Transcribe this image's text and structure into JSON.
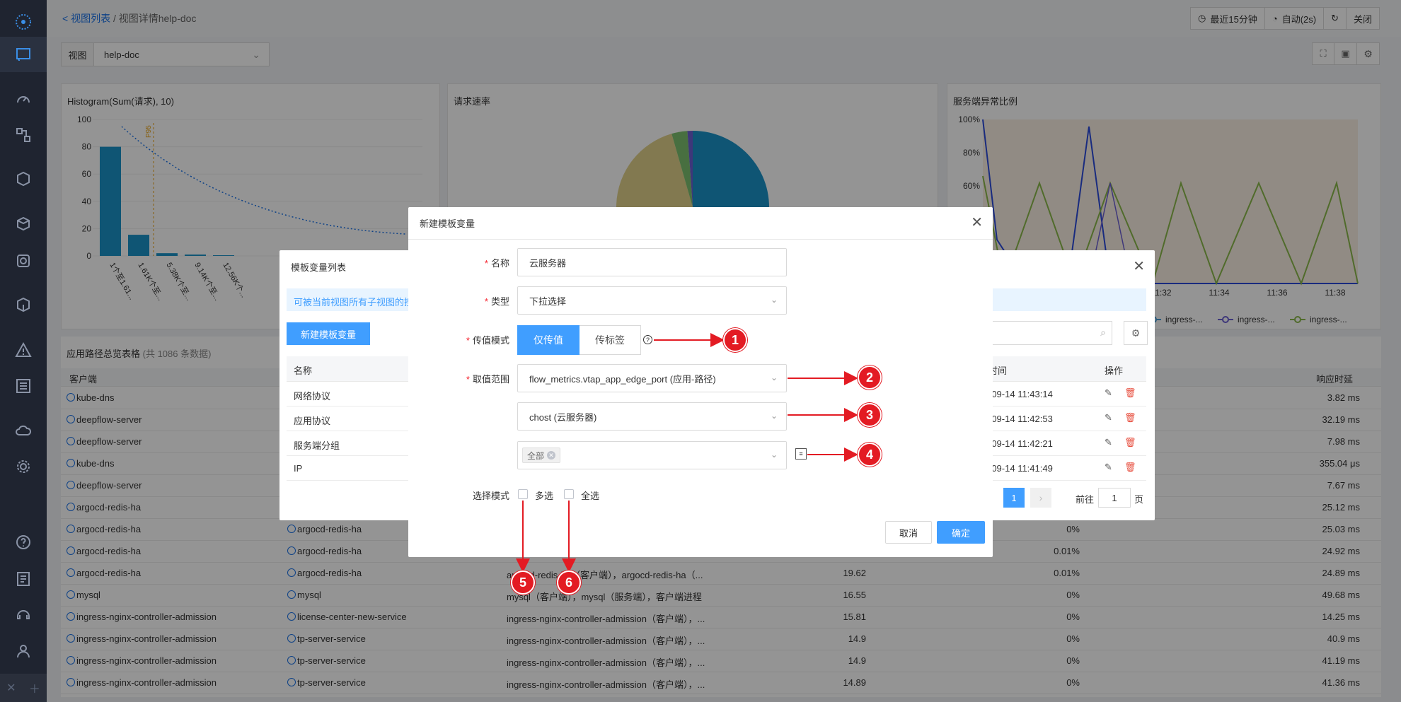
{
  "breadcrumb": {
    "back_link": "视图列表",
    "separator": "/",
    "current": "视图详情help-doc"
  },
  "topbar": {
    "time_range": "最近15分钟",
    "refresh": "自动(2s)",
    "close": "关闭"
  },
  "view_selector": {
    "label": "视图",
    "value": "help-doc"
  },
  "panels": {
    "histogram": {
      "title": "Histogram(Sum(请求), 10)",
      "y_ticks": [
        "100",
        "80",
        "60",
        "40",
        "20",
        "0"
      ],
      "x_labels": [
        "1个至1.61...",
        "1.61K个至...",
        "5.38K个至...",
        "9.14K个至...",
        "12.56K个..."
      ],
      "p95_label": "P95"
    },
    "rate": {
      "title": "请求速率"
    },
    "error_ratio": {
      "title": "服务端异常比例",
      "y_ticks": [
        "100%",
        "80%",
        "60%"
      ],
      "x_ticks": [
        "11:32",
        "11:34",
        "11:36",
        "11:38"
      ],
      "legend": [
        "ingress-...",
        "ingress-...",
        "ingress-..."
      ]
    }
  },
  "chart_data": [
    {
      "type": "bar",
      "title": "Histogram(Sum(请求), 10)",
      "categories": [
        "1个至1.61...",
        "1.61K个至...",
        "5.38K个至...",
        "9.14K个至...",
        "12.56K个..."
      ],
      "values": [
        80,
        15.5,
        2,
        1,
        0.5
      ],
      "ylim": [
        0,
        100
      ]
    },
    {
      "type": "pie",
      "title": "请求速率",
      "values": [
        50,
        36,
        3,
        1
      ]
    }
  ],
  "table": {
    "title": "应用路径总览表格",
    "count": "(共 1086 条数据)",
    "headers": {
      "client": "客户端",
      "latency": "响应时延"
    },
    "rows": [
      {
        "client": "kube-dns",
        "server": "",
        "path": "",
        "rate": "",
        "err": "",
        "latency": "3.82 ms"
      },
      {
        "client": "deepflow-server",
        "server": "",
        "path": "",
        "rate": "",
        "err": "",
        "latency": "32.19 ms"
      },
      {
        "client": "deepflow-server",
        "server": "",
        "path": "",
        "rate": "",
        "err": "",
        "latency": "7.98 ms"
      },
      {
        "client": "kube-dns",
        "server": "",
        "path": "",
        "rate": "",
        "err": "",
        "latency": "355.04 μs"
      },
      {
        "client": "deepflow-server",
        "server": "",
        "path": "",
        "rate": "",
        "err": "",
        "latency": "7.67 ms"
      },
      {
        "client": "argocd-redis-ha",
        "server": "",
        "path": "",
        "rate": "",
        "err": "",
        "latency": "25.12 ms"
      },
      {
        "client": "argocd-redis-ha",
        "server": "argocd-redis-ha",
        "path": "",
        "rate": "",
        "err": "0%",
        "latency": "25.03 ms"
      },
      {
        "client": "argocd-redis-ha",
        "server": "argocd-redis-ha",
        "path": "",
        "rate": "",
        "err": "0.01%",
        "latency": "24.92 ms"
      },
      {
        "client": "argocd-redis-ha",
        "server": "argocd-redis-ha",
        "path": "argocd-redis-ha（客户端），argocd-redis-ha（...",
        "rate": "19.62",
        "err": "0.01%",
        "latency": "24.89 ms"
      },
      {
        "client": "mysql",
        "server": "mysql",
        "path": "mysql（客户端），mysql（服务端），客户端进程",
        "rate": "16.55",
        "err": "0%",
        "latency": "49.68 ms"
      },
      {
        "client": "ingress-nginx-controller-admission",
        "server": "license-center-new-service",
        "path": "ingress-nginx-controller-admission（客户端），...",
        "rate": "15.81",
        "err": "0%",
        "latency": "14.25 ms"
      },
      {
        "client": "ingress-nginx-controller-admission",
        "server": "tp-server-service",
        "path": "ingress-nginx-controller-admission（客户端），...",
        "rate": "14.9",
        "err": "0%",
        "latency": "40.9 ms"
      },
      {
        "client": "ingress-nginx-controller-admission",
        "server": "tp-server-service",
        "path": "ingress-nginx-controller-admission（客户端），...",
        "rate": "14.9",
        "err": "0%",
        "latency": "41.19 ms"
      },
      {
        "client": "ingress-nginx-controller-admission",
        "server": "tp-server-service",
        "path": "ingress-nginx-controller-admission（客户端），...",
        "rate": "14.89",
        "err": "0%",
        "latency": "41.36 ms"
      }
    ]
  },
  "variable_list_dialog": {
    "title": "模板变量列表",
    "info": "可被当前视图所有子视图的搜",
    "new_button": "新建模板变量",
    "col_name": "名称",
    "col_time": "时间",
    "col_ops": "操作",
    "rows": [
      {
        "name": "网络协议",
        "time": "-09-14 11:43:14"
      },
      {
        "name": "应用协议",
        "time": "-09-14 11:42:53"
      },
      {
        "name": "服务端分组",
        "time": "-09-14 11:42:21"
      },
      {
        "name": "IP",
        "time": "-09-14 11:41:49"
      }
    ],
    "page": "1",
    "goto_label": "前往",
    "goto_value": "1",
    "page_suffix": "页"
  },
  "dialog": {
    "title": "新建模板变量",
    "name_label": "名称",
    "name_value": "云服务器",
    "type_label": "类型",
    "type_value": "下拉选择",
    "mode_label": "传值模式",
    "mode_options": [
      "仅传值",
      "传标签"
    ],
    "range_label": "取值范围",
    "range_value1": "flow_metrics.vtap_app_edge_port (应用-路径)",
    "range_value2": "chost (云服务器)",
    "range_tag": "全部",
    "select_mode_label": "选择模式",
    "multi_label": "多选",
    "all_label": "全选",
    "cancel": "取消",
    "confirm": "确定"
  },
  "callouts": [
    "1",
    "2",
    "3",
    "4",
    "5",
    "6"
  ],
  "colors": {
    "primary": "#409eff",
    "callout": "#e31b23",
    "sidebar": "#1f2430"
  }
}
